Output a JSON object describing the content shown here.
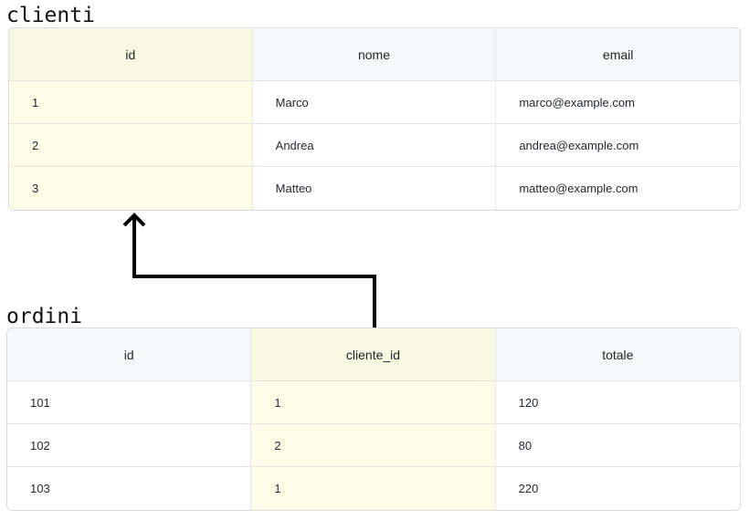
{
  "tables": [
    {
      "title": "clienti",
      "columns": [
        "id",
        "nome",
        "email"
      ],
      "highlight_col": 0,
      "rows": [
        [
          "1",
          "Marco",
          "marco@example.com"
        ],
        [
          "2",
          "Andrea",
          "andrea@example.com"
        ],
        [
          "3",
          "Matteo",
          "matteo@example.com"
        ]
      ]
    },
    {
      "title": "ordini",
      "columns": [
        "id",
        "cliente_id",
        "totale"
      ],
      "highlight_col": 1,
      "rows": [
        [
          "101",
          "1",
          "120"
        ],
        [
          "102",
          "2",
          "80"
        ],
        [
          "103",
          "1",
          "220"
        ]
      ]
    }
  ],
  "relation": {
    "from": "ordini.cliente_id",
    "to": "clienti.id"
  },
  "colors": {
    "highlight": "#fefee6",
    "header_bg": "#f6f8fa",
    "border": "#d8dbe0",
    "arrow": "#000000"
  }
}
